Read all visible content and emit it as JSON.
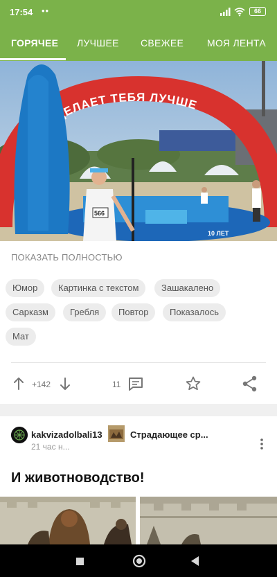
{
  "status": {
    "time": "17:54",
    "notification_dots": "••",
    "battery": "66"
  },
  "tabs": [
    {
      "label": "ГОРЯЧЕЕ",
      "active": true
    },
    {
      "label": "ЛУЧШЕЕ",
      "active": false
    },
    {
      "label": "СВЕЖЕЕ",
      "active": false
    },
    {
      "label": "МОЯ ЛЕНТА",
      "active": false
    }
  ],
  "post1": {
    "image_banner": "ГРЕБЛЯ ДЕЛАЕТ ТЕБЯ ЛУЧШЕ",
    "image_bib": "566",
    "image_sign": "10 ЛЕТ",
    "show_more": "ПОКАЗАТЬ ПОЛНОСТЬЮ",
    "tags": [
      "Юмор",
      "Картинка с текстом",
      "Зашакалено",
      "Сарказм",
      "Гребля",
      "Повтор",
      "Показалось",
      "Мат"
    ],
    "rating": "+142",
    "comments": "11"
  },
  "post2": {
    "author": "kakvizadolbali13",
    "time": "21 час н...",
    "community": "Страдающее ср...",
    "title": "И животноводство!"
  },
  "colors": {
    "brand_green": "#7bb24a",
    "tag_bg": "#ececec",
    "text_muted": "#888888"
  },
  "icons": [
    "upvote-arrow-icon",
    "downvote-arrow-icon",
    "comment-icon",
    "star-icon",
    "share-icon",
    "more-vert-icon",
    "signal-icon",
    "wifi-icon",
    "battery-icon",
    "back-icon",
    "home-icon",
    "recents-icon"
  ]
}
